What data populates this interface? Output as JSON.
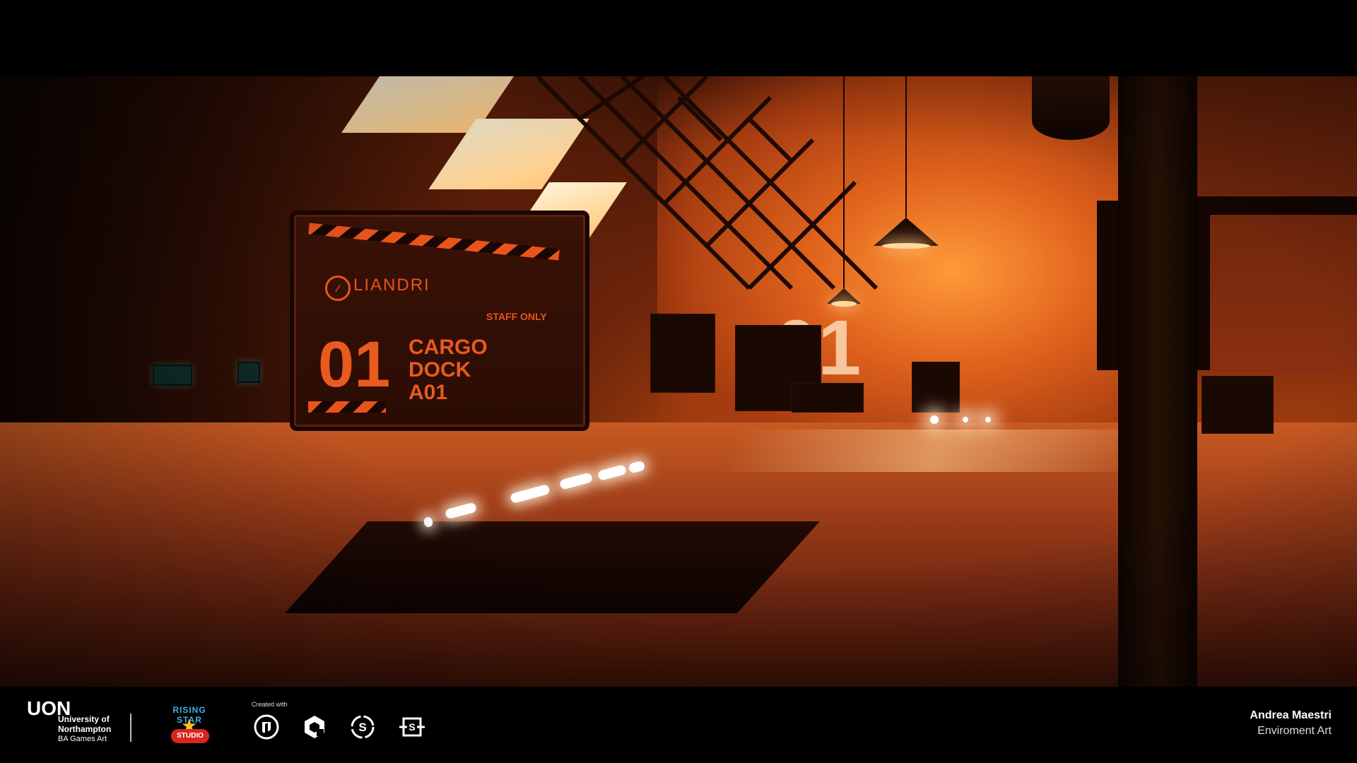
{
  "scene": {
    "sign": {
      "logo_mark": "∕",
      "logo_text": "LIANDRI",
      "staff_label": "STAFF ONLY",
      "number": "01",
      "lines": [
        "CARGO",
        "DOCK",
        "A01"
      ]
    },
    "wall_numeral": "01",
    "colors": {
      "accent_orange": "#e85a1e",
      "sunlight": "#ffd9a0",
      "shadow": "#0d0402"
    }
  },
  "footer": {
    "university": {
      "mark": "UON",
      "line1": "University of",
      "line2": "Northampton",
      "line3": "BA Games Art"
    },
    "rising_star": {
      "text": "RISING STAR",
      "badge": "STUDIO"
    },
    "created_with_label": "Created with",
    "tools": [
      "unreal-engine-icon",
      "quixel-icon",
      "substance-painter-icon",
      "substance-designer-icon"
    ],
    "author_name": "Andrea Maestri",
    "author_role": "Enviroment Art"
  }
}
